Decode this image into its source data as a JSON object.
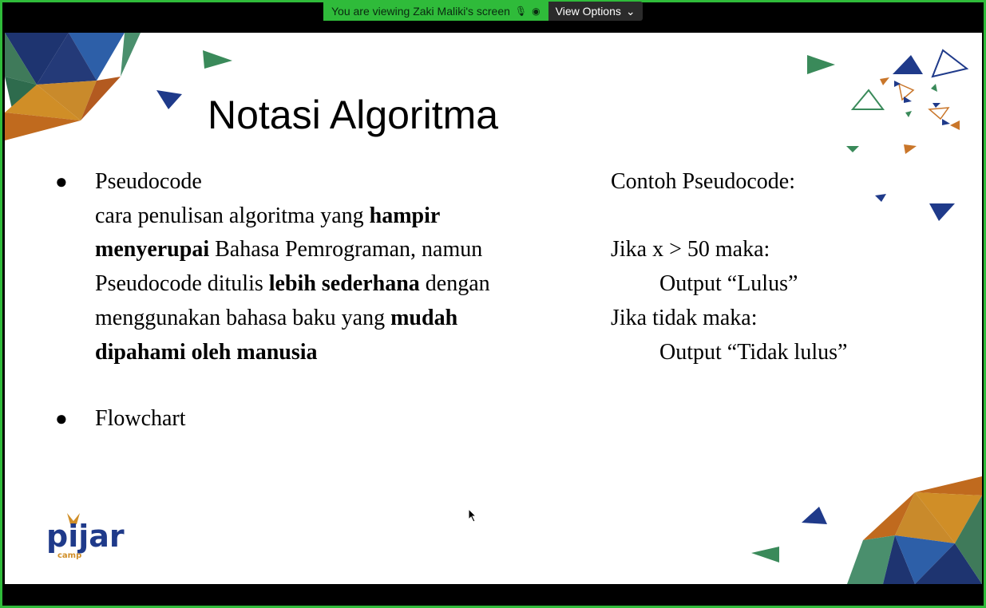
{
  "zoom_bar": {
    "viewing_text": "You are viewing Zaki Maliki's screen",
    "view_options_label": "View Options"
  },
  "slide": {
    "title": "Notasi Algoritma",
    "bullet_char": "●",
    "pseudocode_heading": "Pseudocode",
    "pseudocode_desc": {
      "t1": "cara penulisan algoritma yang ",
      "b1": "hampir",
      "b2": "menyerupai",
      "t2": " Bahasa Pemrograman, namun",
      "t3": "Pseudocode ditulis ",
      "b3": "lebih sederhana",
      "t4": " dengan",
      "t5": "menggunakan bahasa baku yang ",
      "b4": "mudah",
      "b5": "dipahami oleh manusia"
    },
    "flowchart_label": "Flowchart",
    "example": {
      "heading": "Contoh Pseudocode:",
      "line1": "Jika x > 50 maka:",
      "line2": "Output “Lulus”",
      "line3": "Jika tidak maka:",
      "line4": "Output “Tidak lulus”"
    },
    "logo_text": "pijar",
    "logo_sub": "camp"
  },
  "colors": {
    "zoom_green": "#2fbb3a",
    "navy": "#1f3a8a",
    "green": "#3f8f5f",
    "orange": "#c9762a"
  }
}
